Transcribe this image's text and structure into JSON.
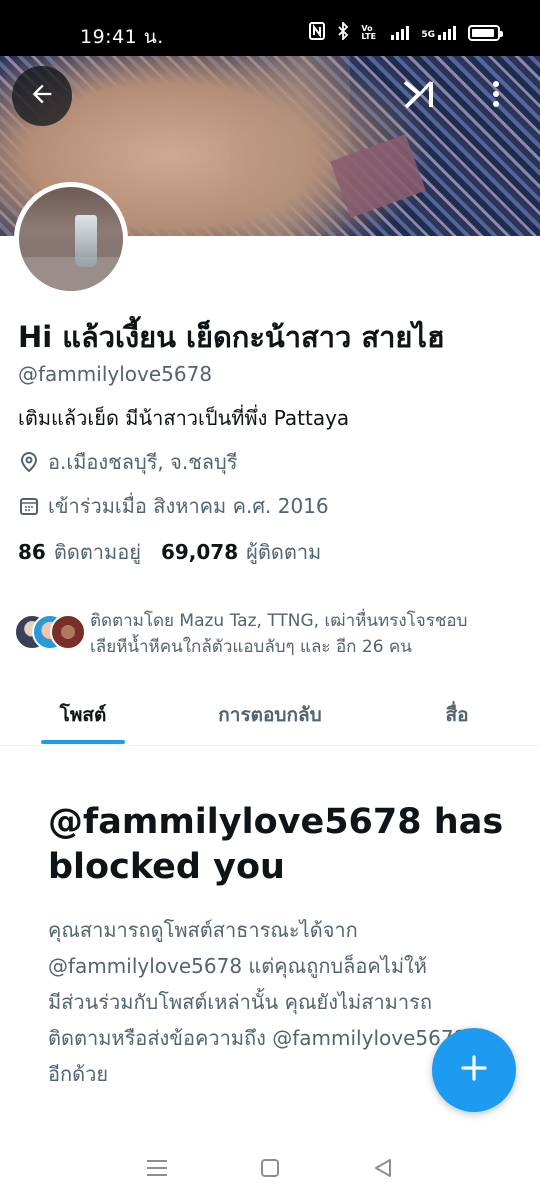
{
  "status_bar": {
    "time": "19:41 น.",
    "icons": [
      "nfc-icon",
      "bluetooth-icon",
      "volte-icon",
      "signal-icon",
      "5g-signal-icon",
      "battery-icon"
    ],
    "volte_label": "Vo LTE",
    "network_label": "5G"
  },
  "header": {
    "back_icon": "back-arrow-icon",
    "xi_icon": "xi-icon",
    "more_icon": "more-vertical-icon"
  },
  "profile": {
    "display_name": "Hi แล้วเงี้ยน เย็ดกะน้าสาว สายไฮ",
    "handle": "@fammilylove5678",
    "bio": "เติมแล้วเย็ด มีน้าสาวเป็นที่พึ่ง  Pattaya",
    "location": "อ.เมืองชลบุรี, จ.ชลบุรี",
    "joined": "เข้าร่วมเมื่อ สิงหาคม ค.ศ. 2016",
    "following_count": "86",
    "following_label": "ติดตามอยู่",
    "followers_count": "69,078",
    "followers_label": "ผู้ติดตาม"
  },
  "followed_by": {
    "line1": "ติดตามโดย Mazu Taz, TTNG, เฒ่าหื่นทรงโจรชอบ",
    "line2": "เลียหีน้ำหีคนใกล้ตัวแอบลับๆ และ อีก 26 คน"
  },
  "tabs": [
    {
      "label": "โพสต์",
      "active": true
    },
    {
      "label": "การตอบกลับ",
      "active": false
    },
    {
      "label": "สื่อ",
      "active": false
    }
  ],
  "blocked": {
    "title": "@fammilylove5678 has blocked you",
    "line1": "คุณสามารถดูโพสต์สาธารณะได้จาก",
    "line2": "@fammilylove5678 แต่คุณถูกบล็อคไม่ให้",
    "line3": "มีส่วนร่วมกับโพสต์เหล่านั้น คุณยังไม่สามารถ",
    "line4": "ติดตามหรือส่งข้อความถึง @fammilylove5678",
    "line5": "อีกด้วย"
  },
  "fab": {
    "icon": "plus-icon"
  },
  "nav_bar": {
    "icons": [
      "recents-icon",
      "home-icon",
      "back-triangle-icon"
    ]
  },
  "colors": {
    "accent": "#1d9bf0",
    "text": "#0f1419",
    "secondary": "#536471"
  }
}
